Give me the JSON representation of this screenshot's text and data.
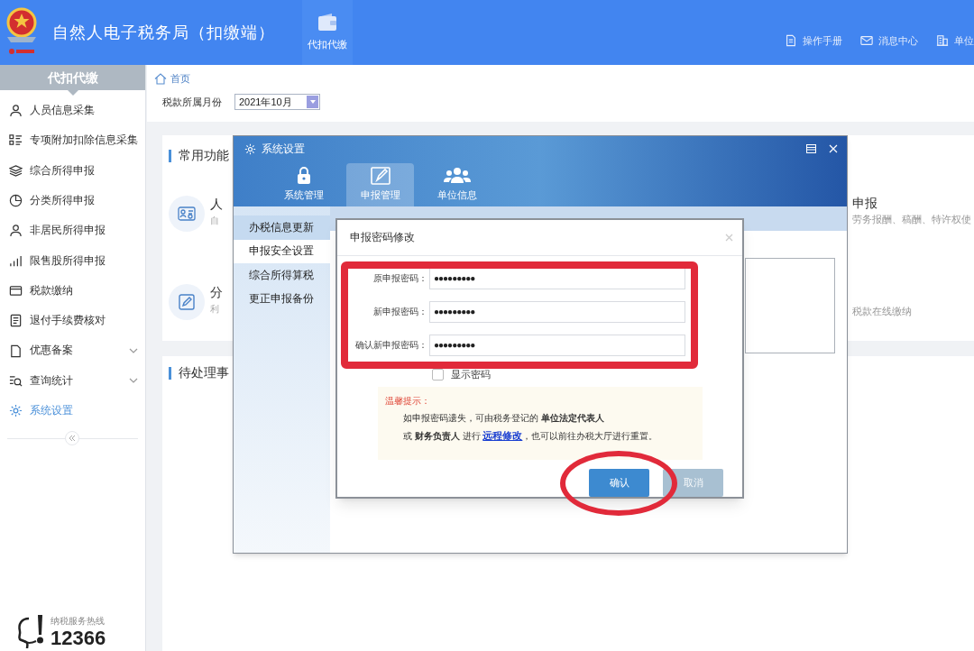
{
  "header": {
    "title": "自然人电子税务局（扣缴端）",
    "nav": [
      {
        "label": "代扣代缴",
        "selected": true
      }
    ],
    "links": [
      {
        "label": "操作手册",
        "kind": "doc"
      },
      {
        "label": "消息中心",
        "kind": "mail"
      },
      {
        "label": "单位",
        "kind": "building"
      }
    ]
  },
  "sidebar": {
    "title": "代扣代缴",
    "items": [
      {
        "label": "人员信息采集",
        "kind": "person",
        "selected": false,
        "expandable": false
      },
      {
        "label": "专项附加扣除信息采集",
        "kind": "list",
        "selected": false,
        "expandable": false
      },
      {
        "label": "综合所得申报",
        "kind": "layers",
        "selected": false,
        "expandable": false
      },
      {
        "label": "分类所得申报",
        "kind": "pie",
        "selected": false,
        "expandable": false
      },
      {
        "label": "非居民所得申报",
        "kind": "person",
        "selected": false,
        "expandable": false
      },
      {
        "label": "限售股所得申报",
        "kind": "bars",
        "selected": false,
        "expandable": false
      },
      {
        "label": "税款缴纳",
        "kind": "wallet",
        "selected": false,
        "expandable": false
      },
      {
        "label": "退付手续费核对",
        "kind": "receipt",
        "selected": false,
        "expandable": false
      },
      {
        "label": "优惠备案",
        "kind": "page",
        "selected": false,
        "expandable": true
      },
      {
        "label": "查询统计",
        "kind": "search",
        "selected": false,
        "expandable": true
      },
      {
        "label": "系统设置",
        "kind": "gear",
        "selected": true,
        "expandable": false
      }
    ],
    "hotline": {
      "label": "纳税服务热线",
      "number": "12366"
    }
  },
  "breadcrumb": "首页",
  "month": {
    "label": "税款所属月份",
    "value": "2021年10月"
  },
  "common": {
    "title": "常用功能",
    "items": [
      {
        "title": "人",
        "subtitle": "自",
        "kind": "idcard"
      },
      {
        "title": "分",
        "subtitle": "利",
        "kind": "edit"
      }
    ],
    "right_items": [
      {
        "title": "申报",
        "subtitle": "劳务报酬、稿酬、特许权使"
      },
      {
        "subtitle": "税款在线缴纳"
      }
    ]
  },
  "pending": {
    "title": "待处理事"
  },
  "settings_dialog": {
    "title": "系统设置",
    "tabs": [
      {
        "label": "系统管理",
        "kind": "lock",
        "selected": false
      },
      {
        "label": "申报管理",
        "kind": "edit",
        "selected": true
      },
      {
        "label": "单位信息",
        "kind": "people",
        "selected": false
      }
    ],
    "nav": [
      {
        "label": "办税信息更新",
        "selected": false
      },
      {
        "label": "申报安全设置",
        "selected": true
      },
      {
        "label": "综合所得算税",
        "selected": false
      },
      {
        "label": "更正申报备份",
        "selected": false
      }
    ]
  },
  "password_dialog": {
    "title": "申报密码修改",
    "fields": [
      {
        "label": "原申报密码：",
        "value": "●●●●●●●●●"
      },
      {
        "label": "新申报密码：",
        "value": "●●●●●●●●●"
      },
      {
        "label": "确认新申报密码：",
        "value": "●●●●●●●●●"
      }
    ],
    "show_password": {
      "label": "显示密码",
      "checked": false
    },
    "tip": {
      "title": "温馨提示：",
      "line1": "如申报密码遗失，可由税务登记的 **单位法定代表人**",
      "line2_before": "或 **财务负责人** 进行 ",
      "line2_link": "远程修改",
      "line2_after": "，也可以前往办税大厅进行重置。"
    },
    "buttons": [
      {
        "label": "确认",
        "kind": "primary"
      },
      {
        "label": "取消",
        "kind": "secondary"
      }
    ]
  },
  "annotations": [
    {
      "kind": "rect"
    },
    {
      "kind": "ellipse"
    }
  ]
}
